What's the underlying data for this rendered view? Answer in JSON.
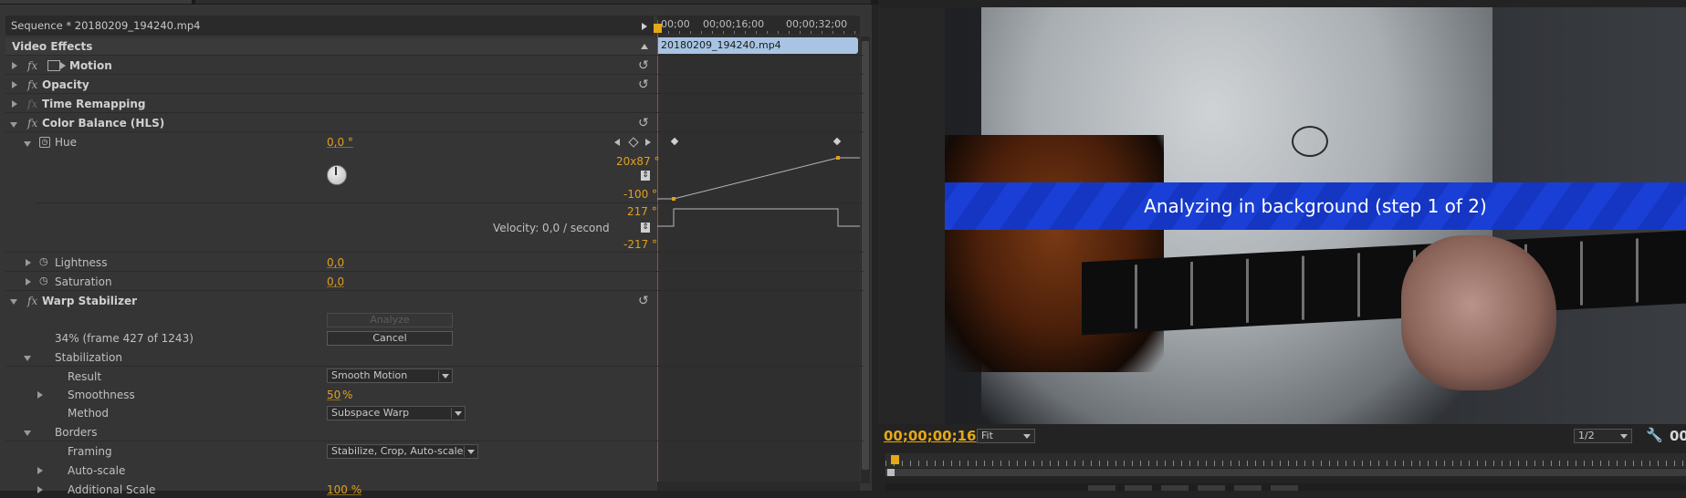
{
  "sequence_title": "Sequence * 20180209_194240.mp4",
  "ruler": {
    "t1": "00;00",
    "t2": "00;00;16;00",
    "t3": "00;00;32;00"
  },
  "clip_name": "20180209_194240.mp4",
  "section": "Video Effects",
  "effects": {
    "motion": "Motion",
    "opacity": "Opacity",
    "time_remap": "Time Remapping",
    "color_balance": "Color Balance (HLS)",
    "hue": {
      "label": "Hue",
      "value": "0,0 °"
    },
    "graph": {
      "max": "20x87 °",
      "min": "-100 °",
      "vmax": "217 °",
      "vmin": "-217 °",
      "velocity": "Velocity: 0,0 / second"
    },
    "lightness": {
      "label": "Lightness",
      "value": "0,0"
    },
    "saturation": {
      "label": "Saturation",
      "value": "0,0"
    },
    "warp": "Warp Stabilizer",
    "analyze_label": "Analyze",
    "progress_text": "34% (frame 427 of 1243)",
    "cancel_label": "Cancel",
    "stabilization": "Stabilization",
    "result": {
      "label": "Result",
      "value": "Smooth Motion"
    },
    "smoothness": {
      "label": "Smoothness",
      "value": "50",
      "unit": "%"
    },
    "method": {
      "label": "Method",
      "value": "Subspace Warp"
    },
    "borders": "Borders",
    "framing": {
      "label": "Framing",
      "value": "Stabilize, Crop, Auto-scale"
    },
    "autoscale": "Auto-scale",
    "additional_scale": {
      "label": "Additional Scale",
      "value": "100 %"
    }
  },
  "program": {
    "banner": "Analyzing in background (step 1 of 2)",
    "timecode": "00;00;00;16",
    "fit": "Fit",
    "resolution": "1/2",
    "tc_right": "00"
  },
  "colors": {
    "accent": "#e0a020",
    "banner": "#1a3fd6",
    "playhead": "#d23a2a"
  }
}
